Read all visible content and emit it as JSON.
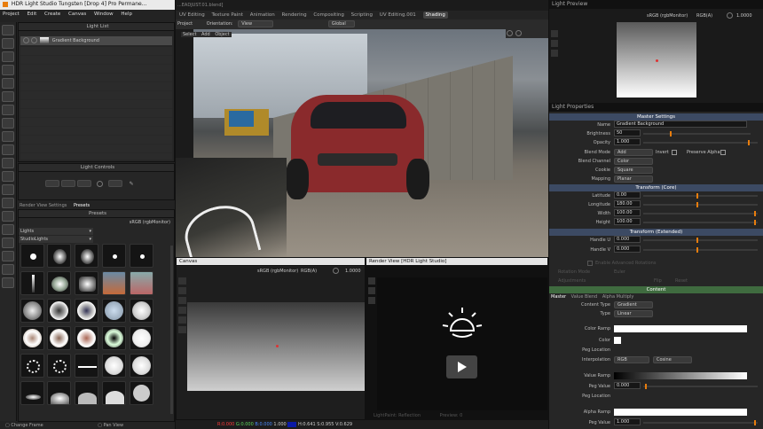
{
  "app": {
    "title": "HDR Light Studio Tungsten [Drop 4]  Pro Permane...",
    "menu": [
      "Project",
      "Edit",
      "Create",
      "Canvas",
      "Window",
      "Help"
    ]
  },
  "blender": {
    "file": "...EADJUST.01.blend]",
    "tabs": [
      "UV Editing",
      "Texture Paint",
      "Animation",
      "Rendering",
      "Compositing",
      "Scripting",
      "UV Editing.001",
      "Shading"
    ],
    "project": "Project",
    "orientation": "Orientation:",
    "view": "View",
    "global": "Global",
    "select": "Select",
    "add": "Add",
    "object": "Object"
  },
  "light_list": {
    "title": "Light List",
    "item": "Gradient Background"
  },
  "light_controls": {
    "title": "Light Controls"
  },
  "tabs": {
    "render_view_settings": "Render View Settings",
    "presets": "Presets"
  },
  "presets": {
    "title": "Presets",
    "colorspace": "sRGB (rgbMonitor)",
    "category": "Lights",
    "subcategory": "StudioLights"
  },
  "canvas": {
    "title": "Canvas",
    "colorspace": "sRGB (rgbMonitor)",
    "channel": "RGB(A)",
    "exposure": "1.0000"
  },
  "render_view": {
    "title": "Render View [HDR Light Studio]",
    "lightpaint": "LightPaint: Reflection",
    "preview": "Preview: 0"
  },
  "light_preview": {
    "title": "Light Preview",
    "colorspace": "sRGB (rgbMonitor)",
    "channel": "RGB(A)",
    "exposure": "1.0000"
  },
  "light_properties": {
    "title": "Light Properties",
    "master_settings": "Master Settings",
    "rows": [
      {
        "label": "Name",
        "value": "Gradient Background"
      },
      {
        "label": "Brightness",
        "value": "50"
      },
      {
        "label": "Opacity",
        "value": "1.000"
      },
      {
        "label": "Blend Mode",
        "value": "Add",
        "extra1": "Invert",
        "extra2": "Preserve Alpha"
      },
      {
        "label": "Blend Channel",
        "value": "Color"
      },
      {
        "label": "Cookie",
        "value": "Square"
      },
      {
        "label": "Mapping",
        "value": "Planar"
      }
    ],
    "transform_core": "Transform (Core)",
    "core_rows": [
      {
        "label": "Latitude",
        "value": "0.00"
      },
      {
        "label": "Longitude",
        "value": "180.00"
      },
      {
        "label": "Width",
        "value": "100.00"
      },
      {
        "label": "Height",
        "value": "100.00"
      }
    ],
    "transform_extended": "Transform (Extended)",
    "ext_rows": [
      {
        "label": "Handle U",
        "value": "0.000"
      },
      {
        "label": "Handle V",
        "value": "0.000"
      }
    ],
    "dim_rows": [
      "Enable Advanced Rotations",
      "Rotation Mode",
      "Adjustments"
    ],
    "dim_values": [
      "Euler",
      "Flip",
      "Reset"
    ],
    "content": "Content",
    "content_tabs": [
      "Master",
      "Value Blend",
      "Alpha Multiply"
    ],
    "content_type": {
      "label": "Content Type",
      "value": "Gradient"
    },
    "type": {
      "label": "Type",
      "value": "Linear"
    },
    "color_ramp": "Color Ramp",
    "color": "Color",
    "peg_location": "Peg Location",
    "interpolation": {
      "label": "Interpolation",
      "value1": "RGB",
      "value2": "Cosine"
    },
    "value_ramp": "Value Ramp",
    "peg_value": {
      "label": "Peg Value",
      "value": "0.000"
    },
    "peg_location2": "Peg Location",
    "alpha_ramp": "Alpha Ramp",
    "peg_value2": {
      "label": "Peg Value",
      "value": "1.000"
    }
  },
  "viewport_status": {
    "r": "R:0.000",
    "g": "G:0.000",
    "b": "B:0.000",
    "a": "1.000",
    "hsv": "H:0.641 S:0.955 V:0.629"
  },
  "status": {
    "change_frame": "Change Frame",
    "pan_view": "Pan View"
  },
  "colors": {
    "accent": "#e87d0d",
    "section": "#3c4a63",
    "content_section": "#3f6b3f",
    "red_status": "#ff3b3b",
    "green_status": "#5cd65c",
    "blue_status": "#4a8bff"
  }
}
